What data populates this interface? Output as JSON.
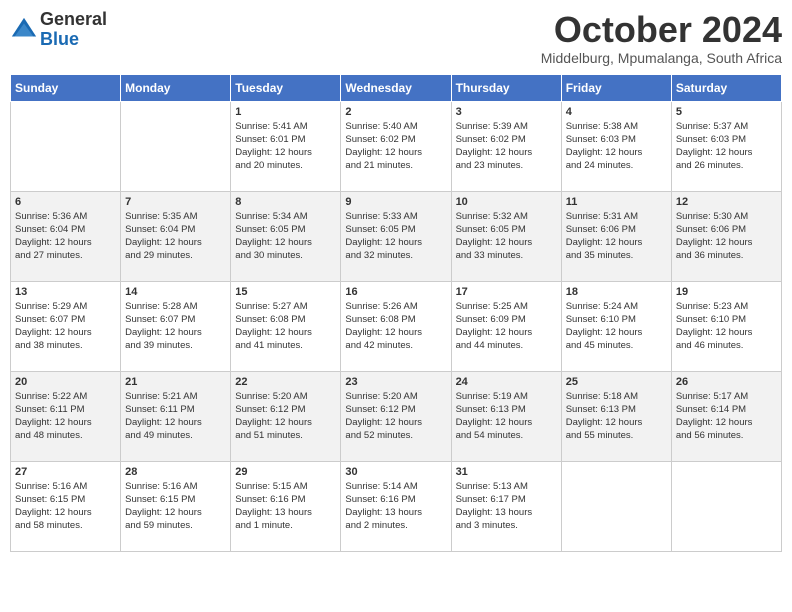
{
  "logo": {
    "general": "General",
    "blue": "Blue"
  },
  "header": {
    "month": "October 2024",
    "location": "Middelburg, Mpumalanga, South Africa"
  },
  "days_header": [
    "Sunday",
    "Monday",
    "Tuesday",
    "Wednesday",
    "Thursday",
    "Friday",
    "Saturday"
  ],
  "weeks": [
    [
      {
        "day": "",
        "info": ""
      },
      {
        "day": "",
        "info": ""
      },
      {
        "day": "1",
        "info": "Sunrise: 5:41 AM\nSunset: 6:01 PM\nDaylight: 12 hours\nand 20 minutes."
      },
      {
        "day": "2",
        "info": "Sunrise: 5:40 AM\nSunset: 6:02 PM\nDaylight: 12 hours\nand 21 minutes."
      },
      {
        "day": "3",
        "info": "Sunrise: 5:39 AM\nSunset: 6:02 PM\nDaylight: 12 hours\nand 23 minutes."
      },
      {
        "day": "4",
        "info": "Sunrise: 5:38 AM\nSunset: 6:03 PM\nDaylight: 12 hours\nand 24 minutes."
      },
      {
        "day": "5",
        "info": "Sunrise: 5:37 AM\nSunset: 6:03 PM\nDaylight: 12 hours\nand 26 minutes."
      }
    ],
    [
      {
        "day": "6",
        "info": "Sunrise: 5:36 AM\nSunset: 6:04 PM\nDaylight: 12 hours\nand 27 minutes."
      },
      {
        "day": "7",
        "info": "Sunrise: 5:35 AM\nSunset: 6:04 PM\nDaylight: 12 hours\nand 29 minutes."
      },
      {
        "day": "8",
        "info": "Sunrise: 5:34 AM\nSunset: 6:05 PM\nDaylight: 12 hours\nand 30 minutes."
      },
      {
        "day": "9",
        "info": "Sunrise: 5:33 AM\nSunset: 6:05 PM\nDaylight: 12 hours\nand 32 minutes."
      },
      {
        "day": "10",
        "info": "Sunrise: 5:32 AM\nSunset: 6:05 PM\nDaylight: 12 hours\nand 33 minutes."
      },
      {
        "day": "11",
        "info": "Sunrise: 5:31 AM\nSunset: 6:06 PM\nDaylight: 12 hours\nand 35 minutes."
      },
      {
        "day": "12",
        "info": "Sunrise: 5:30 AM\nSunset: 6:06 PM\nDaylight: 12 hours\nand 36 minutes."
      }
    ],
    [
      {
        "day": "13",
        "info": "Sunrise: 5:29 AM\nSunset: 6:07 PM\nDaylight: 12 hours\nand 38 minutes."
      },
      {
        "day": "14",
        "info": "Sunrise: 5:28 AM\nSunset: 6:07 PM\nDaylight: 12 hours\nand 39 minutes."
      },
      {
        "day": "15",
        "info": "Sunrise: 5:27 AM\nSunset: 6:08 PM\nDaylight: 12 hours\nand 41 minutes."
      },
      {
        "day": "16",
        "info": "Sunrise: 5:26 AM\nSunset: 6:08 PM\nDaylight: 12 hours\nand 42 minutes."
      },
      {
        "day": "17",
        "info": "Sunrise: 5:25 AM\nSunset: 6:09 PM\nDaylight: 12 hours\nand 44 minutes."
      },
      {
        "day": "18",
        "info": "Sunrise: 5:24 AM\nSunset: 6:10 PM\nDaylight: 12 hours\nand 45 minutes."
      },
      {
        "day": "19",
        "info": "Sunrise: 5:23 AM\nSunset: 6:10 PM\nDaylight: 12 hours\nand 46 minutes."
      }
    ],
    [
      {
        "day": "20",
        "info": "Sunrise: 5:22 AM\nSunset: 6:11 PM\nDaylight: 12 hours\nand 48 minutes."
      },
      {
        "day": "21",
        "info": "Sunrise: 5:21 AM\nSunset: 6:11 PM\nDaylight: 12 hours\nand 49 minutes."
      },
      {
        "day": "22",
        "info": "Sunrise: 5:20 AM\nSunset: 6:12 PM\nDaylight: 12 hours\nand 51 minutes."
      },
      {
        "day": "23",
        "info": "Sunrise: 5:20 AM\nSunset: 6:12 PM\nDaylight: 12 hours\nand 52 minutes."
      },
      {
        "day": "24",
        "info": "Sunrise: 5:19 AM\nSunset: 6:13 PM\nDaylight: 12 hours\nand 54 minutes."
      },
      {
        "day": "25",
        "info": "Sunrise: 5:18 AM\nSunset: 6:13 PM\nDaylight: 12 hours\nand 55 minutes."
      },
      {
        "day": "26",
        "info": "Sunrise: 5:17 AM\nSunset: 6:14 PM\nDaylight: 12 hours\nand 56 minutes."
      }
    ],
    [
      {
        "day": "27",
        "info": "Sunrise: 5:16 AM\nSunset: 6:15 PM\nDaylight: 12 hours\nand 58 minutes."
      },
      {
        "day": "28",
        "info": "Sunrise: 5:16 AM\nSunset: 6:15 PM\nDaylight: 12 hours\nand 59 minutes."
      },
      {
        "day": "29",
        "info": "Sunrise: 5:15 AM\nSunset: 6:16 PM\nDaylight: 13 hours\nand 1 minute."
      },
      {
        "day": "30",
        "info": "Sunrise: 5:14 AM\nSunset: 6:16 PM\nDaylight: 13 hours\nand 2 minutes."
      },
      {
        "day": "31",
        "info": "Sunrise: 5:13 AM\nSunset: 6:17 PM\nDaylight: 13 hours\nand 3 minutes."
      },
      {
        "day": "",
        "info": ""
      },
      {
        "day": "",
        "info": ""
      }
    ]
  ]
}
